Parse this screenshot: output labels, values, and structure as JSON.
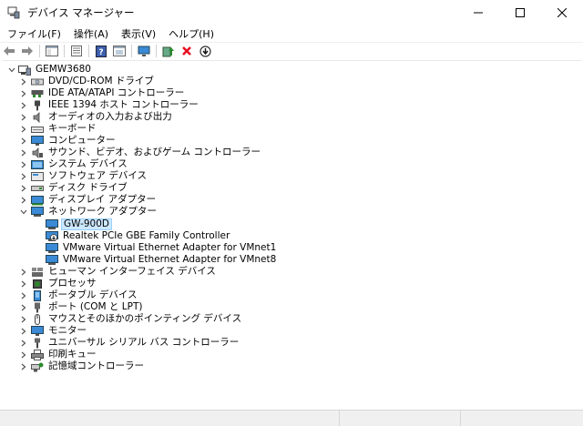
{
  "window": {
    "title": "デバイス マネージャー"
  },
  "menu": [
    {
      "label": "ファイル(F)"
    },
    {
      "label": "操作(A)"
    },
    {
      "label": "表示(V)"
    },
    {
      "label": "ヘルプ(H)"
    }
  ],
  "toolbar": [
    {
      "icon": "back-arrow-icon"
    },
    {
      "icon": "forward-arrow-icon"
    },
    {
      "icon": "show-hide-tree-icon"
    },
    {
      "icon": "properties-icon"
    },
    {
      "icon": "help-icon"
    },
    {
      "icon": "view-icon"
    },
    {
      "icon": "scan-hardware-icon"
    },
    {
      "icon": "update-driver-icon"
    },
    {
      "icon": "uninstall-device-icon"
    },
    {
      "icon": "disable-device-icon"
    }
  ],
  "tree": {
    "root": "GEMW3680",
    "categories": [
      {
        "label": "DVD/CD-ROM ドライブ",
        "icon": "dvd-drive-icon"
      },
      {
        "label": "IDE ATA/ATAPI コントローラー",
        "icon": "ide-controller-icon"
      },
      {
        "label": "IEEE 1394 ホスト コントローラー",
        "icon": "ieee1394-icon"
      },
      {
        "label": "オーディオの入力および出力",
        "icon": "speaker-icon"
      },
      {
        "label": "キーボード",
        "icon": "keyboard-icon"
      },
      {
        "label": "コンピューター",
        "icon": "computer-icon"
      },
      {
        "label": "サウンド、ビデオ、およびゲーム コントローラー",
        "icon": "sound-icon"
      },
      {
        "label": "システム デバイス",
        "icon": "system-device-icon"
      },
      {
        "label": "ソフトウェア デバイス",
        "icon": "software-device-icon"
      },
      {
        "label": "ディスク ドライブ",
        "icon": "disk-drive-icon"
      },
      {
        "label": "ディスプレイ アダプター",
        "icon": "display-adapter-icon"
      },
      {
        "label": "ネットワーク アダプター",
        "icon": "network-adapter-icon",
        "expanded": true,
        "children": [
          {
            "label": "GW-900D",
            "icon": "network-card-icon",
            "selected": true
          },
          {
            "label": "Realtek PCIe GBE Family Controller",
            "icon": "network-card-disabled-icon"
          },
          {
            "label": "VMware Virtual Ethernet Adapter for VMnet1",
            "icon": "network-card-icon"
          },
          {
            "label": "VMware Virtual Ethernet Adapter for VMnet8",
            "icon": "network-card-icon"
          }
        ]
      },
      {
        "label": "ヒューマン インターフェイス デバイス",
        "icon": "hid-icon"
      },
      {
        "label": "プロセッサ",
        "icon": "processor-icon"
      },
      {
        "label": "ポータブル デバイス",
        "icon": "portable-device-icon"
      },
      {
        "label": "ポート (COM と LPT)",
        "icon": "port-icon"
      },
      {
        "label": "マウスとそのほかのポインティング デバイス",
        "icon": "mouse-icon"
      },
      {
        "label": "モニター",
        "icon": "monitor-icon"
      },
      {
        "label": "ユニバーサル シリアル バス コントローラー",
        "icon": "usb-icon"
      },
      {
        "label": "印刷キュー",
        "icon": "printer-icon"
      },
      {
        "label": "記憶域コントローラー",
        "icon": "storage-controller-icon"
      }
    ]
  },
  "colors": {
    "selection_bg": "#cce8ff",
    "selection_border": "#99d1ff",
    "device_icon_blue": "#3a8ad6",
    "uninstall_red": "#e81123",
    "status_bar": "#f0f0f0"
  }
}
